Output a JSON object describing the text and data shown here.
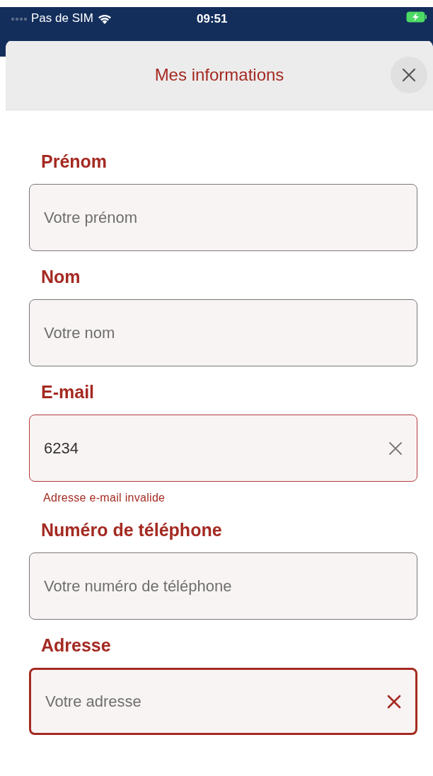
{
  "status_bar": {
    "carrier": "Pas de SIM",
    "time": "09:51"
  },
  "header": {
    "title": "Mes informations"
  },
  "fields": [
    {
      "label": "Prénom",
      "placeholder": "Votre prénom",
      "invalid": false,
      "focused": false
    },
    {
      "label": "Nom",
      "placeholder": "Votre nom",
      "invalid": false,
      "focused": false
    },
    {
      "label": "E-mail",
      "value": "6234",
      "invalid": true,
      "focused": false,
      "clear_button": true,
      "error": "Adresse e-mail invalide"
    },
    {
      "label": "Numéro de téléphone",
      "placeholder": "Votre numéro de téléphone",
      "invalid": false,
      "focused": false
    },
    {
      "label": "Adresse",
      "placeholder": "Votre adresse",
      "invalid": false,
      "focused": true,
      "clear_button": true
    }
  ]
}
